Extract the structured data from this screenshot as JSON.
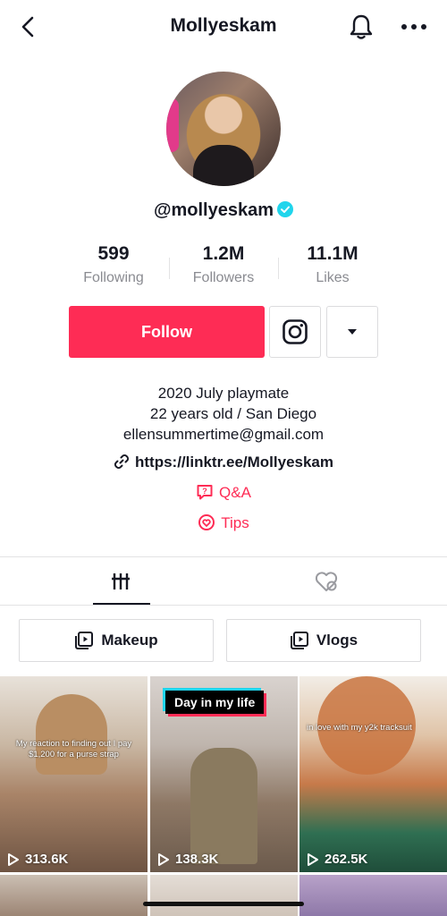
{
  "header": {
    "title": "Mollyeskam"
  },
  "profile": {
    "handle": "@mollyeskam",
    "stats": [
      {
        "value": "599",
        "label": "Following"
      },
      {
        "value": "1.2M",
        "label": "Followers"
      },
      {
        "value": "11.1M",
        "label": "Likes"
      }
    ],
    "follow_label": "Follow",
    "bio_lines": [
      "2020 July playmate",
      "22 years old / San Diego",
      "ellensummertime@gmail.com"
    ],
    "link": "https://linktr.ee/Mollyeskam",
    "qa_label": "Q&A",
    "tips_label": "Tips"
  },
  "playlists": [
    "Makeup",
    "Vlogs"
  ],
  "videos": [
    {
      "views": "313.6K",
      "caption": "My reaction to finding out I pay $1,200 for a purse strap"
    },
    {
      "views": "138.3K",
      "badge": "Day in my life"
    },
    {
      "views": "262.5K",
      "caption": "in love with my y2k tracksuit"
    }
  ],
  "colors": {
    "accent": "#fe2c55",
    "verified": "#20d5ec",
    "text": "#161823",
    "muted": "#8a8b91"
  }
}
